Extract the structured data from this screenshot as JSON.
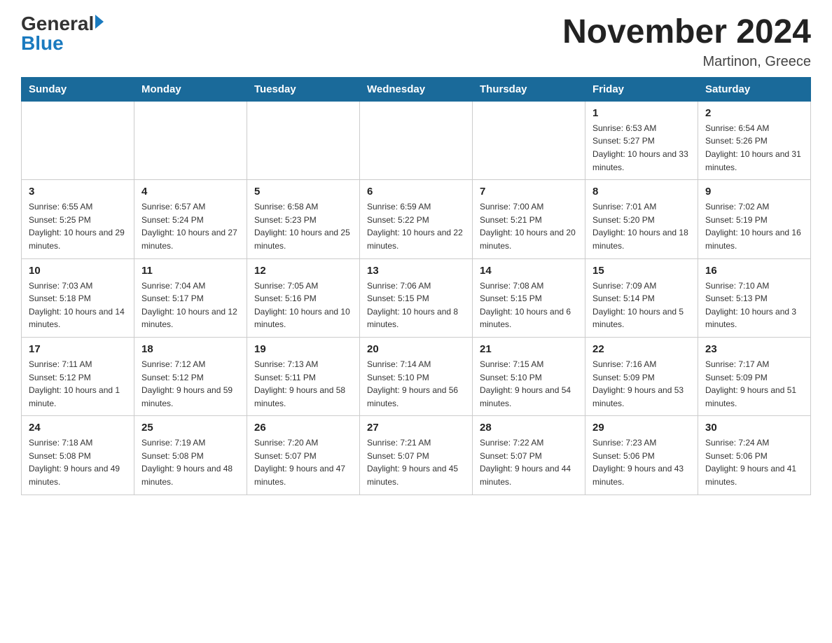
{
  "header": {
    "logo_general": "General",
    "logo_blue": "Blue",
    "month_title": "November 2024",
    "location": "Martinon, Greece"
  },
  "calendar": {
    "days_of_week": [
      "Sunday",
      "Monday",
      "Tuesday",
      "Wednesday",
      "Thursday",
      "Friday",
      "Saturday"
    ],
    "weeks": [
      [
        {
          "day": "",
          "info": ""
        },
        {
          "day": "",
          "info": ""
        },
        {
          "day": "",
          "info": ""
        },
        {
          "day": "",
          "info": ""
        },
        {
          "day": "",
          "info": ""
        },
        {
          "day": "1",
          "info": "Sunrise: 6:53 AM\nSunset: 5:27 PM\nDaylight: 10 hours and 33 minutes."
        },
        {
          "day": "2",
          "info": "Sunrise: 6:54 AM\nSunset: 5:26 PM\nDaylight: 10 hours and 31 minutes."
        }
      ],
      [
        {
          "day": "3",
          "info": "Sunrise: 6:55 AM\nSunset: 5:25 PM\nDaylight: 10 hours and 29 minutes."
        },
        {
          "day": "4",
          "info": "Sunrise: 6:57 AM\nSunset: 5:24 PM\nDaylight: 10 hours and 27 minutes."
        },
        {
          "day": "5",
          "info": "Sunrise: 6:58 AM\nSunset: 5:23 PM\nDaylight: 10 hours and 25 minutes."
        },
        {
          "day": "6",
          "info": "Sunrise: 6:59 AM\nSunset: 5:22 PM\nDaylight: 10 hours and 22 minutes."
        },
        {
          "day": "7",
          "info": "Sunrise: 7:00 AM\nSunset: 5:21 PM\nDaylight: 10 hours and 20 minutes."
        },
        {
          "day": "8",
          "info": "Sunrise: 7:01 AM\nSunset: 5:20 PM\nDaylight: 10 hours and 18 minutes."
        },
        {
          "day": "9",
          "info": "Sunrise: 7:02 AM\nSunset: 5:19 PM\nDaylight: 10 hours and 16 minutes."
        }
      ],
      [
        {
          "day": "10",
          "info": "Sunrise: 7:03 AM\nSunset: 5:18 PM\nDaylight: 10 hours and 14 minutes."
        },
        {
          "day": "11",
          "info": "Sunrise: 7:04 AM\nSunset: 5:17 PM\nDaylight: 10 hours and 12 minutes."
        },
        {
          "day": "12",
          "info": "Sunrise: 7:05 AM\nSunset: 5:16 PM\nDaylight: 10 hours and 10 minutes."
        },
        {
          "day": "13",
          "info": "Sunrise: 7:06 AM\nSunset: 5:15 PM\nDaylight: 10 hours and 8 minutes."
        },
        {
          "day": "14",
          "info": "Sunrise: 7:08 AM\nSunset: 5:15 PM\nDaylight: 10 hours and 6 minutes."
        },
        {
          "day": "15",
          "info": "Sunrise: 7:09 AM\nSunset: 5:14 PM\nDaylight: 10 hours and 5 minutes."
        },
        {
          "day": "16",
          "info": "Sunrise: 7:10 AM\nSunset: 5:13 PM\nDaylight: 10 hours and 3 minutes."
        }
      ],
      [
        {
          "day": "17",
          "info": "Sunrise: 7:11 AM\nSunset: 5:12 PM\nDaylight: 10 hours and 1 minute."
        },
        {
          "day": "18",
          "info": "Sunrise: 7:12 AM\nSunset: 5:12 PM\nDaylight: 9 hours and 59 minutes."
        },
        {
          "day": "19",
          "info": "Sunrise: 7:13 AM\nSunset: 5:11 PM\nDaylight: 9 hours and 58 minutes."
        },
        {
          "day": "20",
          "info": "Sunrise: 7:14 AM\nSunset: 5:10 PM\nDaylight: 9 hours and 56 minutes."
        },
        {
          "day": "21",
          "info": "Sunrise: 7:15 AM\nSunset: 5:10 PM\nDaylight: 9 hours and 54 minutes."
        },
        {
          "day": "22",
          "info": "Sunrise: 7:16 AM\nSunset: 5:09 PM\nDaylight: 9 hours and 53 minutes."
        },
        {
          "day": "23",
          "info": "Sunrise: 7:17 AM\nSunset: 5:09 PM\nDaylight: 9 hours and 51 minutes."
        }
      ],
      [
        {
          "day": "24",
          "info": "Sunrise: 7:18 AM\nSunset: 5:08 PM\nDaylight: 9 hours and 49 minutes."
        },
        {
          "day": "25",
          "info": "Sunrise: 7:19 AM\nSunset: 5:08 PM\nDaylight: 9 hours and 48 minutes."
        },
        {
          "day": "26",
          "info": "Sunrise: 7:20 AM\nSunset: 5:07 PM\nDaylight: 9 hours and 47 minutes."
        },
        {
          "day": "27",
          "info": "Sunrise: 7:21 AM\nSunset: 5:07 PM\nDaylight: 9 hours and 45 minutes."
        },
        {
          "day": "28",
          "info": "Sunrise: 7:22 AM\nSunset: 5:07 PM\nDaylight: 9 hours and 44 minutes."
        },
        {
          "day": "29",
          "info": "Sunrise: 7:23 AM\nSunset: 5:06 PM\nDaylight: 9 hours and 43 minutes."
        },
        {
          "day": "30",
          "info": "Sunrise: 7:24 AM\nSunset: 5:06 PM\nDaylight: 9 hours and 41 minutes."
        }
      ]
    ]
  }
}
